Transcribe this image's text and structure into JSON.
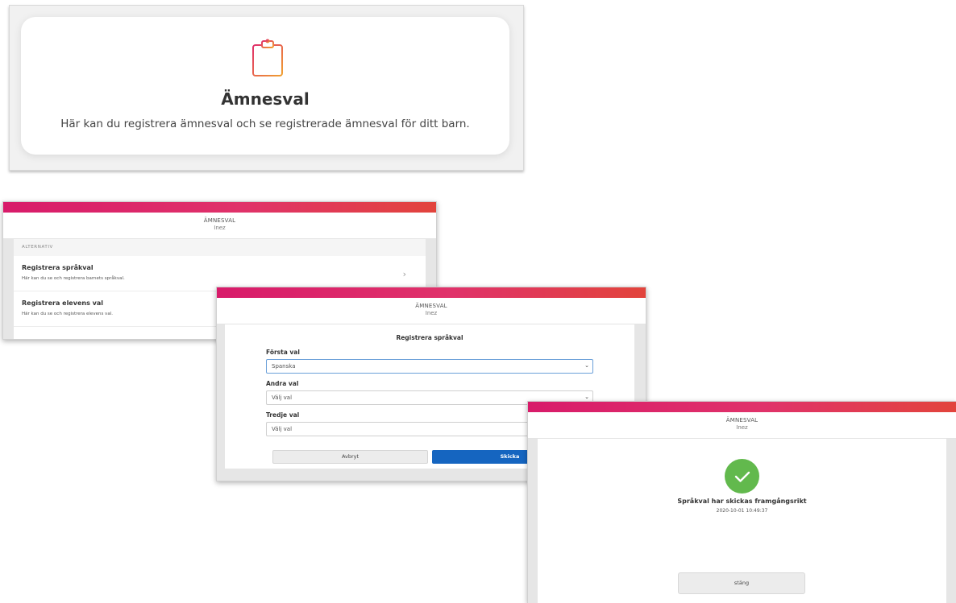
{
  "tile": {
    "icon": "clipboard-icon",
    "title": "Ämnesval",
    "description": "Här kan du registrera ämnesval och se registrerade ämnesval för ditt barn."
  },
  "options_window": {
    "header_title": "ÄMNESVAL",
    "header_subtitle": "Inez",
    "section_label": "ALTERNATIV",
    "items": [
      {
        "title": "Registrera språkval",
        "description": "Här kan du se och registrera barnets språkval."
      },
      {
        "title": "Registrera elevens val",
        "description": "Här kan du se och registrera elevens val."
      }
    ]
  },
  "form_window": {
    "header_title": "ÄMNESVAL",
    "header_subtitle": "Inez",
    "form_title": "Registrera språkval",
    "fields": [
      {
        "label": "Första val",
        "value": "Spanska"
      },
      {
        "label": "Andra val",
        "value": "Välj val"
      },
      {
        "label": "Tredje val",
        "value": "Välj val"
      }
    ],
    "cancel_label": "Avbryt",
    "submit_label": "Skicka"
  },
  "success_window": {
    "header_title": "ÄMNESVAL",
    "header_subtitle": "Inez",
    "message": "Språkval har skickas framgångsrikt",
    "timestamp": "2020-10-01 10:49:37",
    "close_label": "stäng"
  },
  "colors": {
    "header_gradient_start": "#d81b6a",
    "header_gradient_end": "#e2443c",
    "primary_button": "#1565c0",
    "success": "#62b94d",
    "icon_stroke_start": "#e0306b",
    "icon_stroke_end": "#f0a030"
  }
}
